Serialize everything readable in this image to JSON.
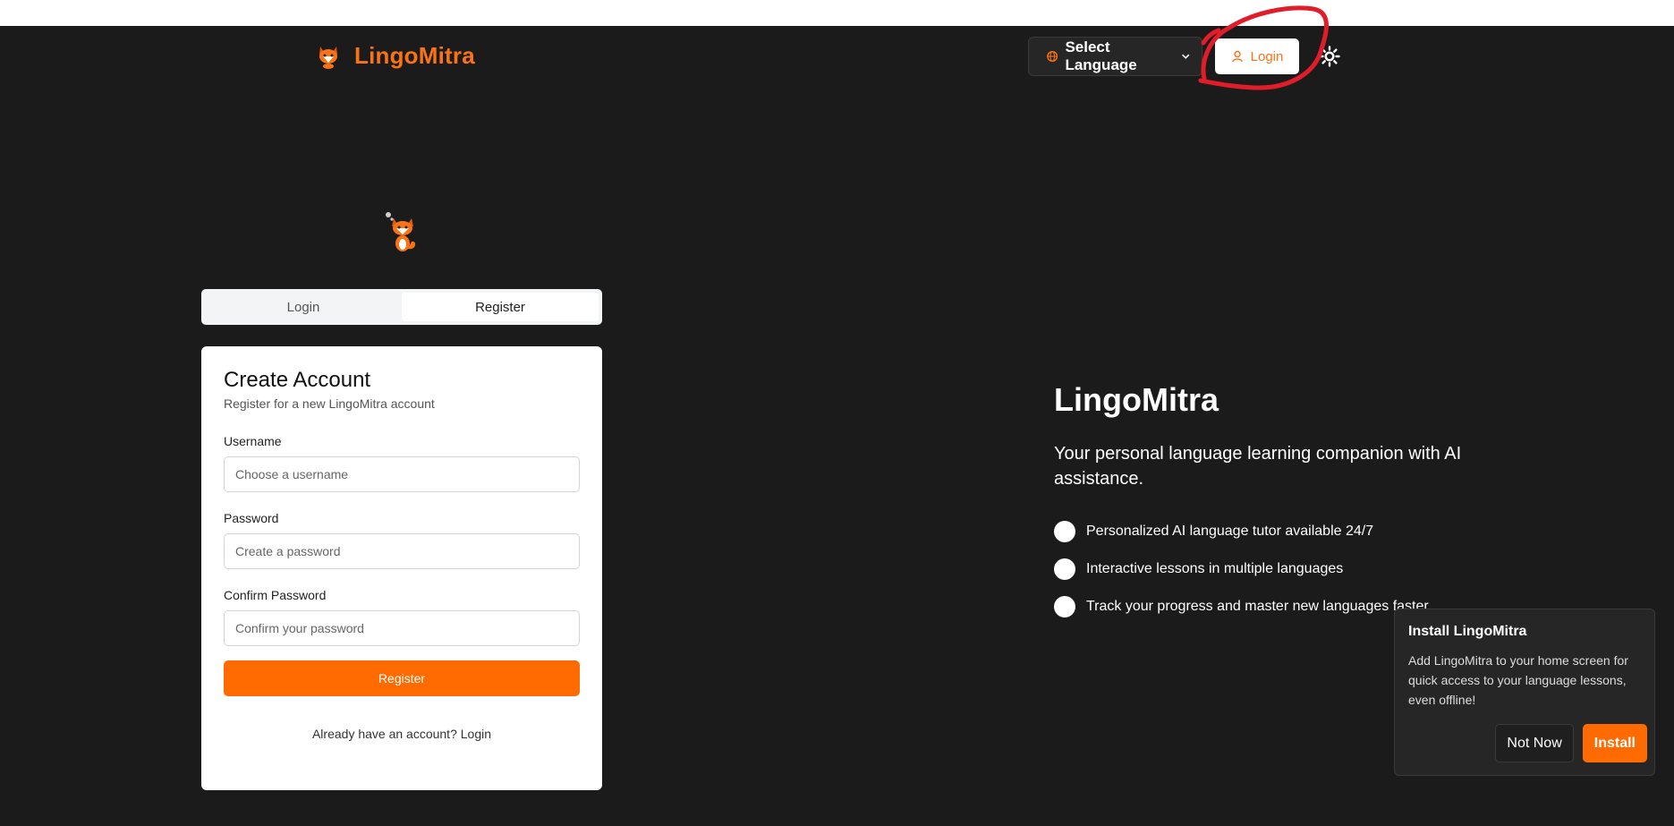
{
  "header": {
    "brand_name": "LingoMitra",
    "language_select_label": "Select Language",
    "login_label": "Login"
  },
  "auth": {
    "tabs": [
      {
        "label": "Login",
        "active": false
      },
      {
        "label": "Register",
        "active": true
      }
    ],
    "card": {
      "title": "Create Account",
      "subtitle": "Register for a new LingoMitra account",
      "username_label": "Username",
      "username_placeholder": "Choose a username",
      "password_label": "Password",
      "password_placeholder": "Create a password",
      "confirm_label": "Confirm Password",
      "confirm_placeholder": "Confirm your password",
      "submit_label": "Register",
      "switch_text": "Already have an account? Login"
    }
  },
  "hero": {
    "title": "LingoMitra",
    "tagline": "Your personal language learning companion with AI assistance.",
    "features": [
      "Personalized AI language tutor available 24/7",
      "Interactive lessons in multiple languages",
      "Track your progress and master new languages faster"
    ]
  },
  "install_prompt": {
    "title": "Install LingoMitra",
    "body": "Add LingoMitra to your home screen for quick access to your language lessons, even offline!",
    "dismiss_label": "Not Now",
    "install_label": "Install"
  },
  "colors": {
    "accent": "#ff6b00",
    "background": "#1b1b1b",
    "annotation": "#e11d2a"
  }
}
